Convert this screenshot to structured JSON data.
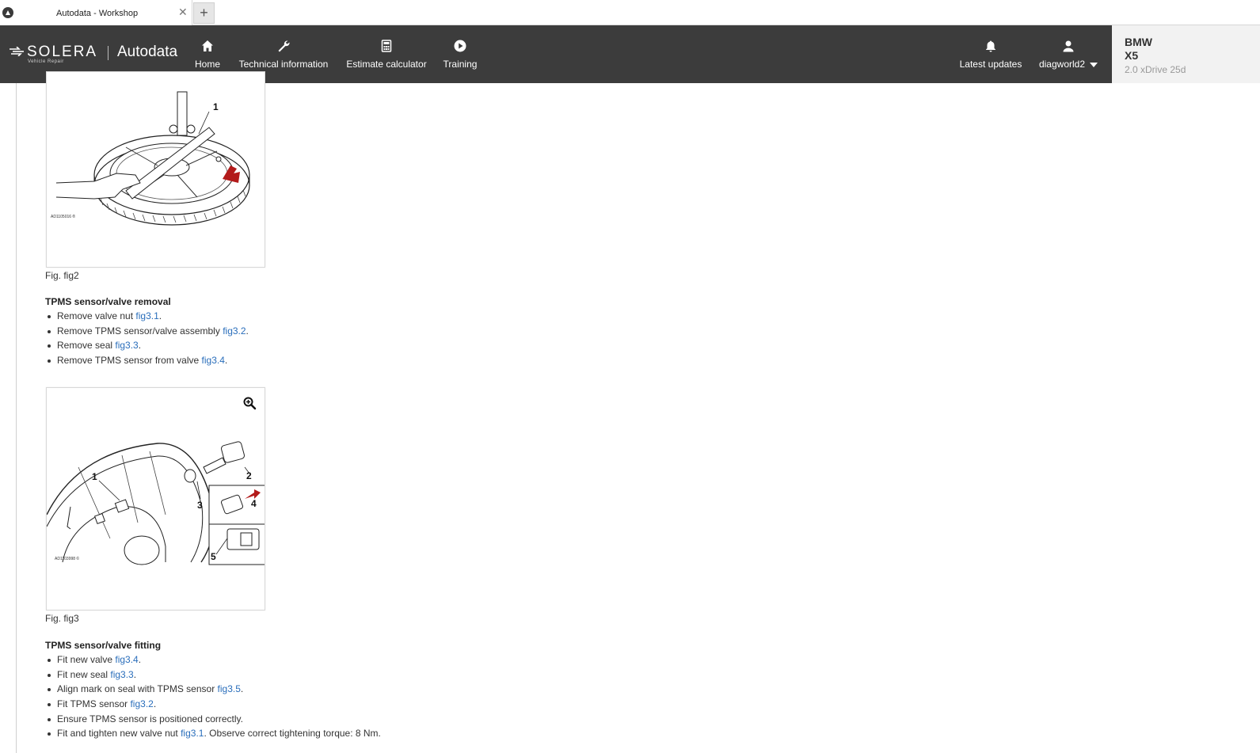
{
  "browser": {
    "tab_title": "Autodata - Workshop",
    "close_glyph": "✕",
    "newtab_glyph": "+"
  },
  "header": {
    "logo": {
      "brand": "SOLERA",
      "tagline": "Vehicle Repair",
      "product": "Autodata"
    },
    "nav": [
      {
        "label": "Home",
        "icon": "home-icon"
      },
      {
        "label": "Technical information",
        "icon": "wrench-icon"
      },
      {
        "label": "Estimate calculator",
        "icon": "calculator-icon"
      },
      {
        "label": "Training",
        "icon": "play-icon"
      }
    ],
    "updates": {
      "label": "Latest updates",
      "icon": "bell-icon"
    },
    "user": {
      "label": "diagworld2",
      "icon": "user-icon"
    },
    "colors": {
      "bar": "#3c3c3c",
      "link": "#2a6ebb"
    }
  },
  "vehicle": {
    "make": "BMW",
    "model": "X5",
    "variant": "2.0 xDrive 25d"
  },
  "content": {
    "fig2": {
      "caption": "Fig. fig2",
      "callout_1": "1",
      "ref_code": "AD1105016 ®"
    },
    "removal": {
      "title": "TPMS sensor/valve removal",
      "steps": [
        {
          "text": "Remove valve nut ",
          "link": "fig3.1",
          "after": "."
        },
        {
          "text": "Remove TPMS sensor/valve assembly ",
          "link": "fig3.2",
          "after": "."
        },
        {
          "text": "Remove seal ",
          "link": "fig3.3",
          "after": "."
        },
        {
          "text": "Remove TPMS sensor from valve ",
          "link": "fig3.4",
          "after": "."
        }
      ]
    },
    "fig3": {
      "caption": "Fig. fig3",
      "callouts": [
        "1",
        "2",
        "3",
        "4",
        "5"
      ],
      "ref_code": "AD1103998 ©"
    },
    "fitting": {
      "title": "TPMS sensor/valve fitting",
      "steps": [
        {
          "text": "Fit new valve ",
          "link": "fig3.4",
          "after": "."
        },
        {
          "text": "Fit new seal ",
          "link": "fig3.3",
          "after": "."
        },
        {
          "text": "Align mark on seal with TPMS sensor ",
          "link": "fig3.5",
          "after": "."
        },
        {
          "text": "Fit TPMS sensor ",
          "link": "fig3.2",
          "after": "."
        },
        {
          "text": "Ensure TPMS sensor is positioned correctly.",
          "link": "",
          "after": ""
        },
        {
          "text": "Fit and tighten new valve nut ",
          "link": "fig3.1",
          "after": ". Observe correct tightening torque: 8 Nm."
        }
      ]
    }
  }
}
